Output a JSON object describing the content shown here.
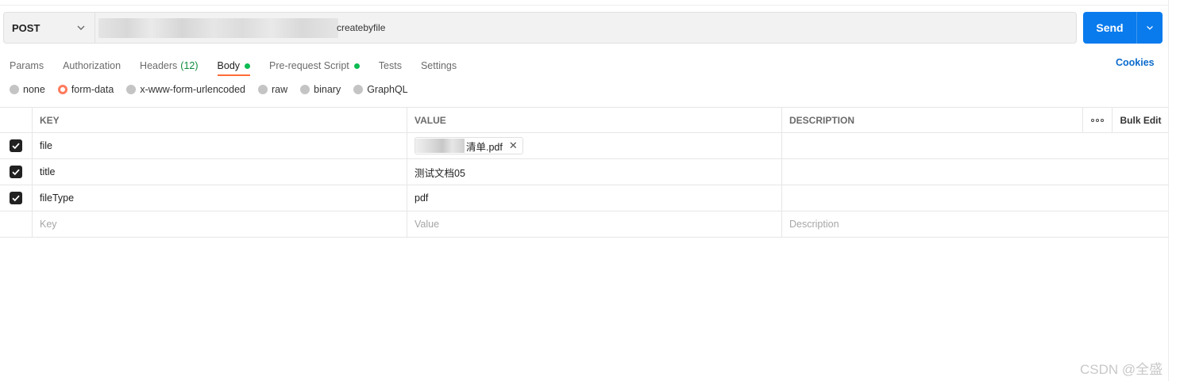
{
  "request": {
    "method": "POST",
    "url_suffix": "createbyfile"
  },
  "send": {
    "label": "Send"
  },
  "tabs": [
    {
      "label": "Params"
    },
    {
      "label": "Authorization"
    },
    {
      "label": "Headers",
      "count": "(12)"
    },
    {
      "label": "Body"
    },
    {
      "label": "Pre-request Script"
    },
    {
      "label": "Tests"
    },
    {
      "label": "Settings"
    }
  ],
  "cookies_label": "Cookies",
  "body_types": [
    "none",
    "form-data",
    "x-www-form-urlencoded",
    "raw",
    "binary",
    "GraphQL"
  ],
  "table": {
    "headers": {
      "key": "KEY",
      "value": "VALUE",
      "description": "DESCRIPTION",
      "bulk_edit": "Bulk Edit"
    },
    "rows": [
      {
        "key": "file",
        "value": "清单.pdf",
        "description": ""
      },
      {
        "key": "title",
        "value": "测试文档05",
        "description": ""
      },
      {
        "key": "fileType",
        "value": "pdf",
        "description": ""
      }
    ],
    "placeholders": {
      "key": "Key",
      "value": "Value",
      "description": "Description"
    }
  },
  "watermark": "CSDN @全盛",
  "colors": {
    "accent": "#ff6c37",
    "send": "#097bed",
    "status_green": "#0cbb52",
    "link": "#0b6bcb"
  },
  "icons": [
    "chevron-down-icon",
    "close-icon",
    "more-icon",
    "checkbox-checked-icon"
  ]
}
